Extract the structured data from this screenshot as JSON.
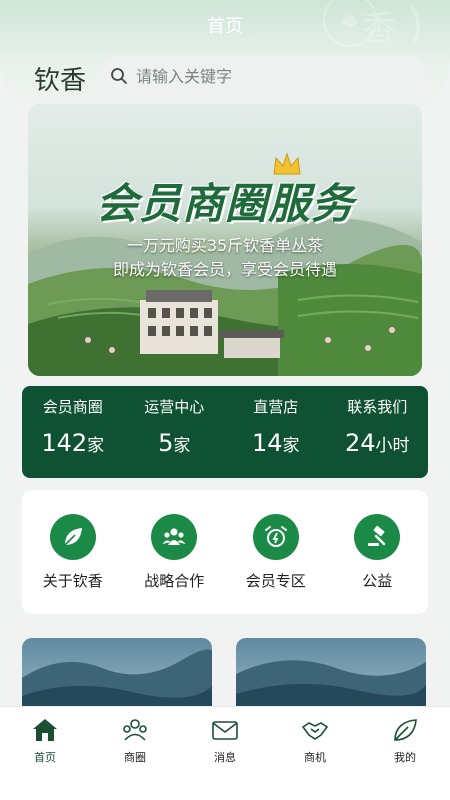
{
  "nav": {
    "title": "首页"
  },
  "header": {
    "brand": "钦香",
    "watermark_text": "香"
  },
  "search": {
    "placeholder": "请输入关键字"
  },
  "banner": {
    "title": "会员商圈服务",
    "line1": "一万元购买35斤钦香单丛茶",
    "line2": "即成为钦香会员，享受会员待遇"
  },
  "stats": [
    {
      "label": "会员商圈",
      "value": "142",
      "unit": "家"
    },
    {
      "label": "运营中心",
      "value": "5",
      "unit": "家"
    },
    {
      "label": "直营店",
      "value": "14",
      "unit": "家"
    },
    {
      "label": "联系我们",
      "value": "24",
      "unit": "小时"
    }
  ],
  "quick_links": [
    {
      "label": "关于钦香",
      "icon": "leaf-icon"
    },
    {
      "label": "战略合作",
      "icon": "people-icon"
    },
    {
      "label": "会员专区",
      "icon": "alarm-clock-icon"
    },
    {
      "label": "公益",
      "icon": "gavel-icon"
    }
  ],
  "tabs": [
    {
      "label": "首页",
      "icon": "home-icon",
      "active": true
    },
    {
      "label": "商圈",
      "icon": "circle-people-icon",
      "active": false
    },
    {
      "label": "消息",
      "icon": "mail-icon",
      "active": false
    },
    {
      "label": "商机",
      "icon": "handshake-icon",
      "active": false
    },
    {
      "label": "我的",
      "icon": "leaf-outline-icon",
      "active": false
    }
  ],
  "colors": {
    "primary": "#0f5233",
    "accent": "#1a8a46",
    "page_bg": "#f1f3f2"
  }
}
